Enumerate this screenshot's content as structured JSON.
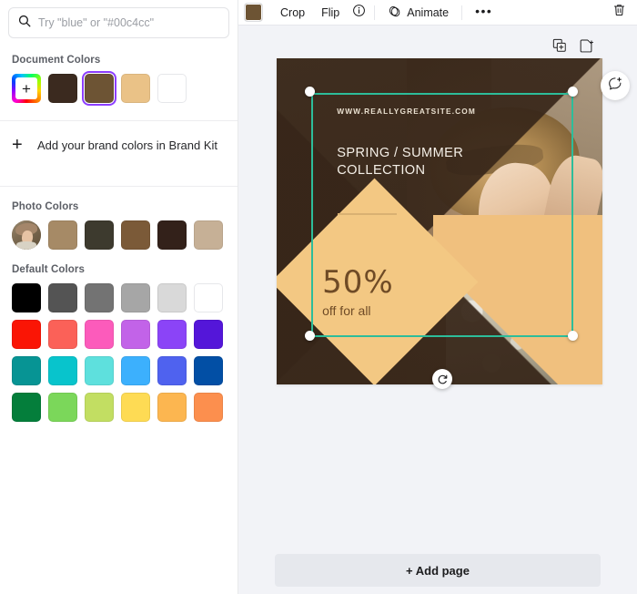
{
  "search": {
    "placeholder": "Try \"blue\" or \"#00c4cc\"",
    "value": "",
    "icon": "search-icon"
  },
  "sections": {
    "document_colors": {
      "title": "Document Colors",
      "add_icon": "plus-icon",
      "swatches": [
        {
          "name": "rainbow-picker",
          "color": "rainbow",
          "selected": false
        },
        {
          "name": "swatch-dark-brown",
          "color": "#3b2a1f",
          "selected": false
        },
        {
          "name": "swatch-medium-brown",
          "color": "#6d5434",
          "selected": true
        },
        {
          "name": "swatch-tan",
          "color": "#eac287",
          "selected": false
        },
        {
          "name": "swatch-white",
          "color": "#ffffff",
          "selected": false
        }
      ]
    },
    "brand_kit": {
      "plus": "+",
      "label": "Add your brand colors in Brand Kit"
    },
    "photo_colors": {
      "title": "Photo Colors",
      "thumbnail_name": "photo-thumbnail",
      "swatches": [
        {
          "name": "photo-swatch-1",
          "color": "#a68a66"
        },
        {
          "name": "photo-swatch-2",
          "color": "#3d3a2e"
        },
        {
          "name": "photo-swatch-3",
          "color": "#7b5a38"
        },
        {
          "name": "photo-swatch-4",
          "color": "#33211a"
        },
        {
          "name": "photo-swatch-5",
          "color": "#c6b096"
        }
      ]
    },
    "default_colors": {
      "title": "Default Colors",
      "swatches": [
        {
          "name": "swatch-black",
          "color": "#000000"
        },
        {
          "name": "swatch-dark-gray",
          "color": "#545454"
        },
        {
          "name": "swatch-gray",
          "color": "#737373"
        },
        {
          "name": "swatch-light-gray",
          "color": "#a6a6a6"
        },
        {
          "name": "swatch-lighter-gray",
          "color": "#d9d9d9"
        },
        {
          "name": "swatch-white",
          "color": "#ffffff"
        },
        {
          "name": "swatch-red",
          "color": "#fa1505"
        },
        {
          "name": "swatch-salmon",
          "color": "#fb6158"
        },
        {
          "name": "swatch-pink",
          "color": "#fc5bbb"
        },
        {
          "name": "swatch-orchid",
          "color": "#c263e8"
        },
        {
          "name": "swatch-purple",
          "color": "#8b44f7"
        },
        {
          "name": "swatch-violet",
          "color": "#5416d9"
        },
        {
          "name": "swatch-teal",
          "color": "#079494"
        },
        {
          "name": "swatch-cyan",
          "color": "#08c4cc"
        },
        {
          "name": "swatch-aqua",
          "color": "#5ee0dd"
        },
        {
          "name": "swatch-sky-blue",
          "color": "#3cb0fd"
        },
        {
          "name": "swatch-blue",
          "color": "#4f62ef"
        },
        {
          "name": "swatch-navy",
          "color": "#024fa5"
        },
        {
          "name": "swatch-green",
          "color": "#047e3b"
        },
        {
          "name": "swatch-light-green",
          "color": "#7bd75a"
        },
        {
          "name": "swatch-lime",
          "color": "#c2de62"
        },
        {
          "name": "swatch-yellow",
          "color": "#fedb54"
        },
        {
          "name": "swatch-light-orange",
          "color": "#fcb650"
        },
        {
          "name": "swatch-orange",
          "color": "#fc8f4e"
        }
      ]
    }
  },
  "toolbar": {
    "color_swatch": "#6d5434",
    "crop_label": "Crop",
    "flip_label": "Flip",
    "info_icon": "info-icon",
    "animate_icon": "animate-icon",
    "animate_label": "Animate",
    "more_label": "•••",
    "trash_icon": "trash-icon"
  },
  "page_tools": {
    "duplicate_icon": "duplicate-page-icon",
    "add_page_icon": "add-page-icon",
    "comment_icon": "add-comment-icon"
  },
  "design": {
    "url_text": "WWW.REALLYGREATSITE.COM",
    "headline_line1": "SPRING / SUMMER",
    "headline_line2": "COLLECTION",
    "discount": "50%",
    "discount_sub": "off for all",
    "colors": {
      "dark_brown": "#372619",
      "tan": "#f0c07e",
      "diamond": "#f3c883",
      "text_brown": "#6f4b26",
      "selection": "#2dbd9a"
    }
  },
  "footer": {
    "add_page_label": "+ Add page"
  }
}
